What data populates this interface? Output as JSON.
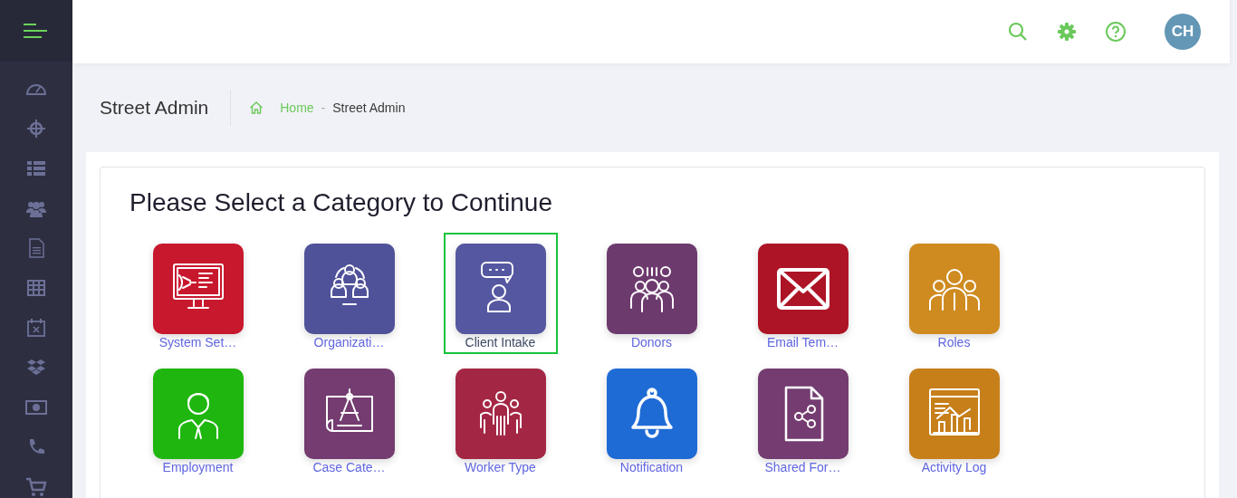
{
  "header": {
    "avatar": "CH"
  },
  "page": {
    "title": "Street Admin",
    "breadcrumb": [
      {
        "label": "Home",
        "kind": "link"
      },
      {
        "label": "-",
        "kind": "separator"
      },
      {
        "label": "Street Admin",
        "kind": "current"
      }
    ]
  },
  "categories": {
    "heading": "Please Select a Category to Continue",
    "tiles": [
      {
        "label": "System Set…",
        "color": "#c8182d",
        "selected": false
      },
      {
        "label": "Organizati…",
        "color": "#4f5199",
        "selected": false
      },
      {
        "label": "Client Intake",
        "color": "#5557a0",
        "selected": true
      },
      {
        "label": "Donors",
        "color": "#6d3a6e",
        "selected": false
      },
      {
        "label": "Email Tem…",
        "color": "#ad1426",
        "selected": false
      },
      {
        "label": "Roles",
        "color": "#cf8b20",
        "selected": false
      },
      {
        "label": "Employment",
        "color": "#1fb60f",
        "selected": false
      },
      {
        "label": "Case Cate…",
        "color": "#743c70",
        "selected": false
      },
      {
        "label": "Worker Type",
        "color": "#a42645",
        "selected": false
      },
      {
        "label": "Notification",
        "color": "#1f6bd6",
        "selected": false
      },
      {
        "label": "Shared For…",
        "color": "#743c70",
        "selected": false
      },
      {
        "label": "Activity Log",
        "color": "#c77f1a",
        "selected": false
      }
    ]
  }
}
